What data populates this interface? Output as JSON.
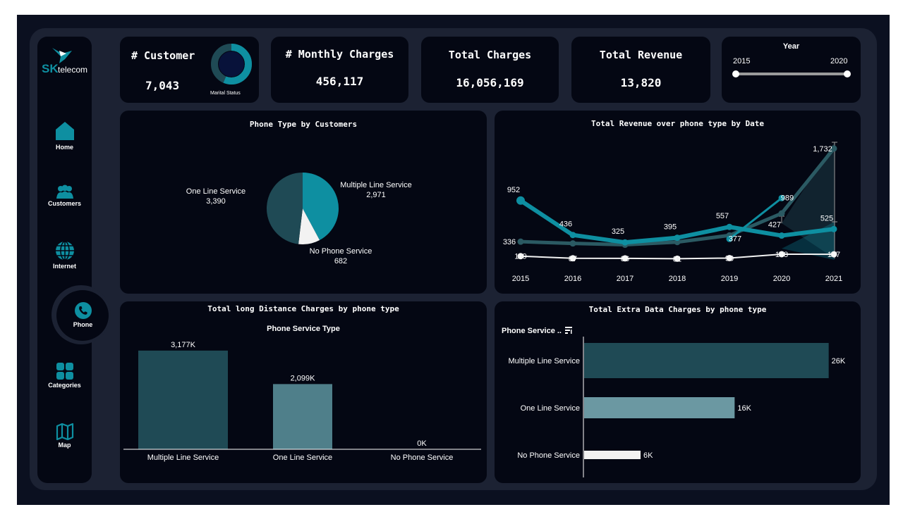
{
  "app": {
    "logo_main": "SK",
    "logo_sub": "telecom"
  },
  "colors": {
    "dark_teal": "#1f4a55",
    "teal": "#0e8fa1",
    "light_teal": "#6b98a2",
    "mid_teal": "#4f7f8a",
    "white": "#f2f2f2",
    "panel": "#040713"
  },
  "nav": [
    {
      "label": "Home",
      "icon": "home-icon"
    },
    {
      "label": "Customers",
      "icon": "users-icon"
    },
    {
      "label": "Internet",
      "icon": "globe-icon"
    },
    {
      "label": "Phone",
      "icon": "phone-icon",
      "active": true
    },
    {
      "label": "Categories",
      "icon": "grid-icon"
    },
    {
      "label": "Map",
      "icon": "map-icon"
    }
  ],
  "kpis": {
    "customer": {
      "title": "# Customer",
      "value": "7,043",
      "donut_caption": "Marital Status"
    },
    "monthly": {
      "title": "# Monthly Charges",
      "value": "456,117"
    },
    "total_charges": {
      "title": "Total Charges",
      "value": "16,056,169"
    },
    "total_revenue": {
      "title": "Total Revenue",
      "value": "13,820"
    }
  },
  "year_filter": {
    "title": "Year",
    "min_label": "2015",
    "max_label": "2020"
  },
  "chart_data": [
    {
      "type": "pie",
      "title": "Phone Type by Customers",
      "slices": [
        {
          "name": "Multiple Line Service",
          "label": "2,971",
          "value": 2971,
          "color": "#0e8fa1"
        },
        {
          "name": "No Phone Service",
          "label": "682",
          "value": 682,
          "color": "#f2f2f2"
        },
        {
          "name": "One Line Service",
          "label": "3,390",
          "value": 3390,
          "color": "#1f4a55"
        }
      ]
    },
    {
      "type": "line",
      "title": "Total Revenue over phone type by Date",
      "x": [
        "2015",
        "2016",
        "2017",
        "2018",
        "2019",
        "2020",
        "2021"
      ],
      "ylim": [
        0,
        1900
      ],
      "series": [
        {
          "color": "#2b5a63",
          "values": [
            336,
            310,
            290,
            330,
            430,
            760,
            1732
          ],
          "labels": [
            "336",
            "",
            "",
            "",
            "",
            "",
            "1,732"
          ]
        },
        {
          "color": "#0e8fa1",
          "values": [
            952,
            436,
            325,
            395,
            557,
            427,
            525
          ],
          "labels": [
            "952",
            "436",
            "325",
            "395",
            "557",
            "427",
            "525"
          ]
        },
        {
          "color": "#0e8fa1",
          "values": [
            null,
            null,
            null,
            null,
            377,
            989,
            null
          ],
          "labels": [
            "",
            "",
            "",
            "",
            "377",
            "989",
            ""
          ]
        },
        {
          "color": "#f2f2f2",
          "values": [
            119,
            87,
            86,
            81,
            90,
            148,
            147
          ],
          "labels": [
            "119",
            "87",
            "86",
            "81",
            "90",
            "148",
            "147"
          ]
        }
      ]
    },
    {
      "type": "bar",
      "title": "Total long Distance Charges by phone type",
      "subtitle": "Phone Service Type",
      "categories": [
        "Multiple Line Service",
        "One Line Service",
        "No Phone Service"
      ],
      "values": [
        3177,
        2099,
        0
      ],
      "labels": [
        "3,177K",
        "2,099K",
        "0K"
      ],
      "colors": [
        "#1f4a55",
        "#4f7f8a",
        "#f2f2f2"
      ],
      "ylim": [
        0,
        3400
      ]
    },
    {
      "type": "bar",
      "orientation": "horizontal",
      "title": "Total Extra Data Charges by phone type",
      "ylabel": "Phone Service ..",
      "categories": [
        "Multiple Line Service",
        "One Line Service",
        "No Phone Service"
      ],
      "values": [
        26,
        16,
        6
      ],
      "labels": [
        "26K",
        "16K",
        "6K"
      ],
      "colors": [
        "#1f4a55",
        "#6b98a2",
        "#f2f2f2"
      ],
      "xlim": [
        0,
        27
      ]
    }
  ]
}
